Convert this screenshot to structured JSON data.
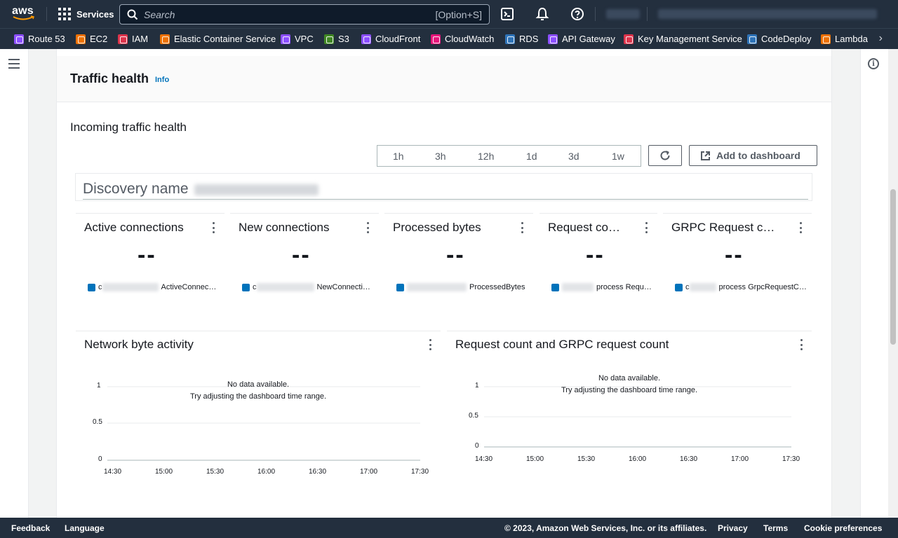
{
  "topnav": {
    "logo_text": "aws",
    "services_label": "Services",
    "search_placeholder": "Search",
    "search_shortcut": "[Option+S]"
  },
  "favorites": [
    {
      "label": "Route 53",
      "color": "#8c4fff"
    },
    {
      "label": "EC2",
      "color": "#ed7100"
    },
    {
      "label": "IAM",
      "color": "#dd344c"
    },
    {
      "label": "Elastic Container Service",
      "color": "#ed7100"
    },
    {
      "label": "VPC",
      "color": "#8c4fff"
    },
    {
      "label": "S3",
      "color": "#3f8624"
    },
    {
      "label": "CloudFront",
      "color": "#8c4fff"
    },
    {
      "label": "CloudWatch",
      "color": "#e7157b"
    },
    {
      "label": "RDS",
      "color": "#2e73b8"
    },
    {
      "label": "API Gateway",
      "color": "#8c4fff"
    },
    {
      "label": "Key Management Service",
      "color": "#dd344c"
    },
    {
      "label": "CodeDeploy",
      "color": "#2e73b8"
    },
    {
      "label": "Lambda",
      "color": "#ed7100"
    }
  ],
  "section": {
    "title": "Traffic health",
    "info_link": "Info",
    "subheading": "Incoming traffic health"
  },
  "time_range": [
    "1h",
    "3h",
    "12h",
    "1d",
    "3d",
    "1w"
  ],
  "add_to_dashboard": "Add to dashboard",
  "discovery_label": "Discovery name",
  "metrics": [
    {
      "title": "Active connections",
      "value": "--",
      "legend_suffix": "ActiveConnec…",
      "legend_prefix": "c"
    },
    {
      "title": "New connections",
      "value": "--",
      "legend_suffix": "NewConnecti…",
      "legend_prefix": "c"
    },
    {
      "title": "Processed bytes",
      "value": "--",
      "legend_suffix": "ProcessedBytes",
      "legend_prefix": ""
    },
    {
      "title": "Request co…",
      "value": "--",
      "legend_suffix": "process Requ…",
      "legend_prefix": ""
    },
    {
      "title": "GRPC Request c…",
      "value": "--",
      "legend_suffix": "process GrpcRequestC…",
      "legend_prefix": "c"
    }
  ],
  "charts": [
    {
      "title": "Network byte activity",
      "no_data_line1": "No data available.",
      "no_data_line2": "Try adjusting the dashboard time range.",
      "y_ticks": [
        "1",
        "0.5",
        "0"
      ],
      "x_ticks": [
        "14:30",
        "15:00",
        "15:30",
        "16:00",
        "16:30",
        "17:00",
        "17:30"
      ]
    },
    {
      "title": "Request count and GRPC request count",
      "no_data_line1": "No data available.",
      "no_data_line2": "Try adjusting the dashboard time range.",
      "y_ticks": [
        "1",
        "0.5",
        "0"
      ],
      "x_ticks": [
        "14:30",
        "15:00",
        "15:30",
        "16:00",
        "16:30",
        "17:00",
        "17:30"
      ]
    }
  ],
  "footer": {
    "feedback": "Feedback",
    "language": "Language",
    "copyright": "© 2023, Amazon Web Services, Inc. or its affiliates.",
    "privacy": "Privacy",
    "terms": "Terms",
    "cookies": "Cookie preferences"
  }
}
